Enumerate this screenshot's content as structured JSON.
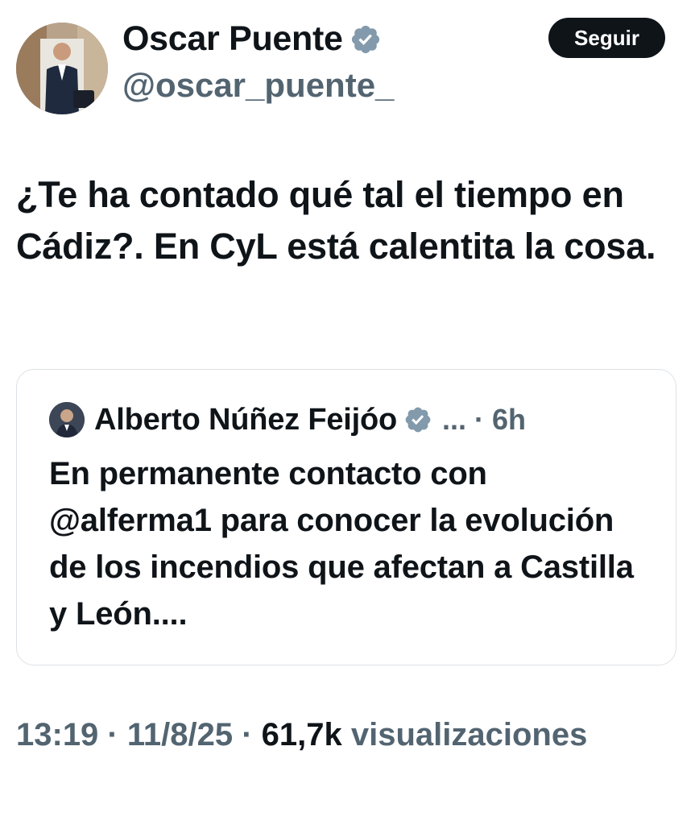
{
  "author": {
    "display_name": "Oscar Puente",
    "handle": "@oscar_puente_",
    "avatar_icon": "profile-photo",
    "verified_icon": "verified-badge-icon"
  },
  "follow_button": {
    "label": "Seguir"
  },
  "tweet": {
    "text": "¿Te ha contado qué tal el tiempo en Cádiz?. En CyL está calentita la cosa."
  },
  "quoted_tweet": {
    "author_name": "Alberto Núñez Feijóo",
    "meta": "... · 6h",
    "text": "En permanente contacto con @alferma1 para conocer la evolución de los incendios que afectan a Castilla y León...."
  },
  "footer": {
    "time_date": "13:19 · 11/8/25 · ",
    "views_count": "61,7k",
    "views_label": " visualizaciones"
  },
  "colors": {
    "text_primary": "#0f1419",
    "text_secondary": "#536471",
    "border": "#dde2e6",
    "verified_badge": "#829aab"
  }
}
